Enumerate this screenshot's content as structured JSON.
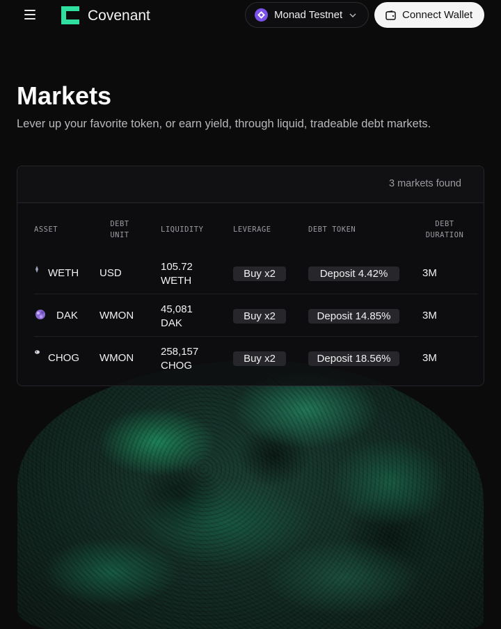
{
  "header": {
    "menu_icon": "hamburger-icon",
    "brand": "Covenant",
    "network": {
      "label": "Monad Testnet",
      "icon": "monad-icon"
    },
    "connect_label": "Connect Wallet"
  },
  "hero": {
    "title": "Markets",
    "subtitle": "Lever up your favorite token, or earn yield, through liquid, tradeable debt markets."
  },
  "markets": {
    "count_text": "3 markets found",
    "columns": {
      "asset": "ASSET",
      "debt_unit_1": "DEBT",
      "debt_unit_2": "UNIT",
      "liquidity": "LIQUIDITY",
      "leverage": "LEVERAGE",
      "debt_token": "DEBT TOKEN",
      "debt_duration_1": "DEBT",
      "debt_duration_2": "DURATION"
    },
    "rows": [
      {
        "asset": "WETH",
        "debt_unit": "USD",
        "liquidity_value": "105.72",
        "liquidity_unit": "WETH",
        "leverage": "Buy x2",
        "debt_token": "Deposit 4.42%",
        "duration": "3M"
      },
      {
        "asset": "DAK",
        "debt_unit": "WMON",
        "liquidity_value": "45,081",
        "liquidity_unit": "DAK",
        "leverage": "Buy x2",
        "debt_token": "Deposit 14.85%",
        "duration": "3M"
      },
      {
        "asset": "CHOG",
        "debt_unit": "WMON",
        "liquidity_value": "258,157",
        "liquidity_unit": "CHOG",
        "leverage": "Buy x2",
        "debt_token": "Deposit 18.56%",
        "duration": "3M"
      }
    ]
  },
  "colors": {
    "accent": "#2fe0a0",
    "background": "#0b0b0c",
    "pill": "#26262b"
  }
}
